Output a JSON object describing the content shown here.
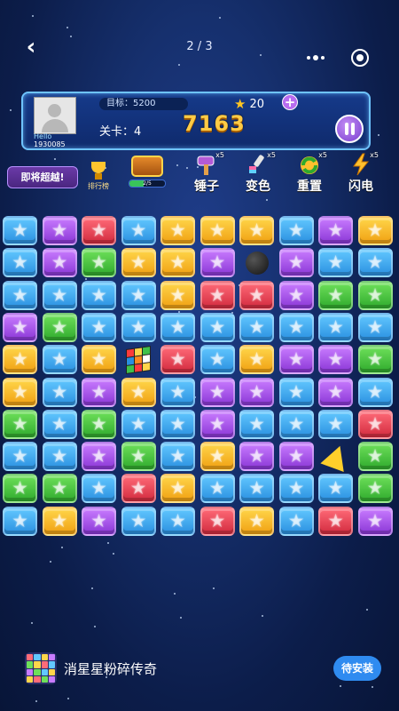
{
  "nav": {
    "back_label": "‹",
    "page_indicator": "2 / 3"
  },
  "player": {
    "name": "Hello",
    "id": "1930085"
  },
  "status": {
    "target_label": "目标：5200",
    "stars": "20",
    "level_label": "关卡：4",
    "score": "7163"
  },
  "actions": {
    "soon_label": "即将超越!",
    "rank_label": "排行榜",
    "chest_progress_label": "2/5",
    "chest_progress_fraction": 0.4
  },
  "tools": [
    {
      "label": "锤子",
      "badge": "x5",
      "icon": "hammer-icon",
      "color": "#b45ad6"
    },
    {
      "label": "变色",
      "badge": "x5",
      "icon": "brush-icon",
      "color": "#e5e5e5"
    },
    {
      "label": "重置",
      "badge": "x5",
      "icon": "reset-icon",
      "color": "#ffc02e"
    },
    {
      "label": "闪电",
      "badge": "x5",
      "icon": "lightning-icon",
      "color": "#ffc02e"
    }
  ],
  "board": {
    "legend": {
      "b": "blue-star",
      "p": "purple-star",
      "r": "red-star",
      "y": "yellow-star",
      "g": "green-star",
      "X": "bomb",
      "C": "rubik-cube",
      "L": "lightning-bolt"
    },
    "rows": [
      "bprbyyybpy",
      "bpgyypXpbb",
      "bbbbyrrpgg",
      "pgbbbbbbbb",
      "ybyCrbyppg",
      "ybpybppbpb",
      "gbgbbpbbbr",
      "bbpgbyppLg",
      "ggbrybbbbg",
      "bypbbrybrp"
    ]
  },
  "footer": {
    "app_name": "消星星粉碎传奇",
    "install_label": "待安装"
  }
}
